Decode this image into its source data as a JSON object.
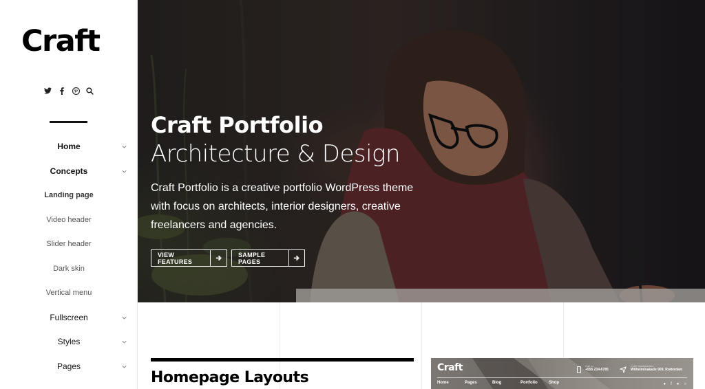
{
  "sidebar": {
    "logo": "Craft",
    "social_icons": [
      "twitter-icon",
      "facebook-icon",
      "pinterest-icon",
      "search-icon"
    ],
    "menu": [
      {
        "label": "Home",
        "dropdown": true
      },
      {
        "label": "Concepts",
        "dropdown": true
      },
      {
        "label": "Landing page",
        "dropdown": false
      },
      {
        "label": "Video header",
        "dropdown": false
      },
      {
        "label": "Slider header",
        "dropdown": false
      },
      {
        "label": "Dark skin",
        "dropdown": false
      },
      {
        "label": "Vertical menu",
        "dropdown": false
      },
      {
        "label": "Fullscreen",
        "dropdown": true
      },
      {
        "label": "Styles",
        "dropdown": true
      },
      {
        "label": "Pages",
        "dropdown": true
      }
    ]
  },
  "hero": {
    "title": "Craft Portfolio",
    "subtitle": "Architecture & Design",
    "description": "Craft Portfolio is a creative portfolio WordPress theme with focus on architects, interior designers, creative freelancers and agencies.",
    "buttons": {
      "features": "VIEW FEATURES",
      "samples": "SAMPLE PAGES"
    }
  },
  "section": {
    "title": "Homepage Layouts"
  },
  "preview": {
    "logo": "Craft",
    "phone_label": "Call us",
    "phone": "+555 234-6785",
    "address_label": "Craft headquarters",
    "address": "Wilhelminakade 909, Rotterdam",
    "nav": [
      "Home",
      "Pages",
      "Blog",
      "Portfolio",
      "Shop"
    ]
  }
}
